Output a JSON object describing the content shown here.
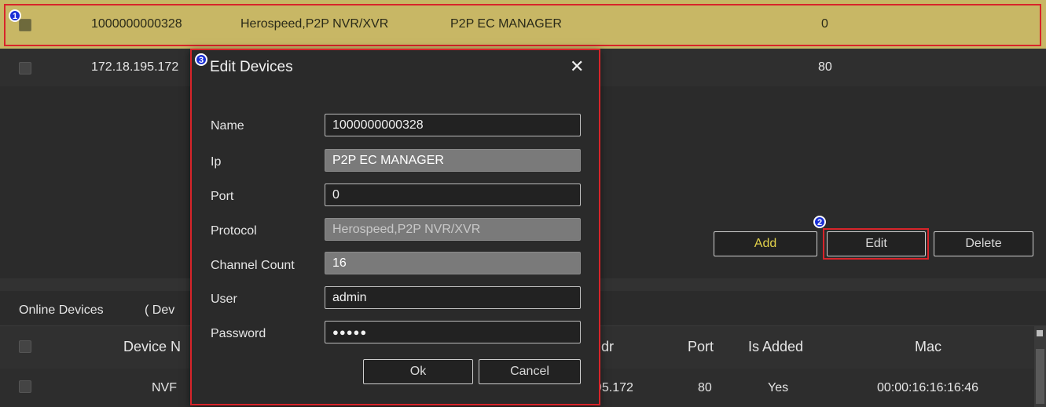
{
  "added_rows": [
    {
      "name": "1000000000328",
      "protocol": "Herospeed,P2P NVR/XVR",
      "ip": "P2P EC MANAGER",
      "port": "0"
    },
    {
      "name": "172.18.195.172",
      "port": "80"
    }
  ],
  "buttons": {
    "add": "Add",
    "edit": "Edit",
    "delete": "Delete"
  },
  "online": {
    "title": "Online Devices",
    "subtitle_fragment": "( Dev",
    "headers": {
      "device_name": "Device N",
      "addr": "dr",
      "port": "Port",
      "is_added": "Is Added",
      "mac": "Mac"
    },
    "row": {
      "device_name": "NVF",
      "addr": "95.172",
      "port": "80",
      "is_added": "Yes",
      "mac": "00:00:16:16:16:46"
    }
  },
  "dialog": {
    "title": "Edit Devices",
    "close": "✕",
    "labels": {
      "name": "Name",
      "ip": "Ip",
      "port": "Port",
      "protocol": "Protocol",
      "channel_count": "Channel Count",
      "user": "User",
      "password": "Password"
    },
    "values": {
      "name": "1000000000328",
      "ip": "P2P EC MANAGER",
      "port": "0",
      "protocol": "Herospeed,P2P NVR/XVR",
      "channel_count": "16",
      "user": "admin",
      "password": "●●●●●"
    },
    "ok": "Ok",
    "cancel": "Cancel"
  },
  "markers": {
    "m1": "1",
    "m2": "2",
    "m3": "3"
  },
  "colors": {
    "selected_row": "#c8b765",
    "highlight": "#d8242a",
    "marker": "#1a2fd6",
    "add_text": "#e2d14a"
  }
}
